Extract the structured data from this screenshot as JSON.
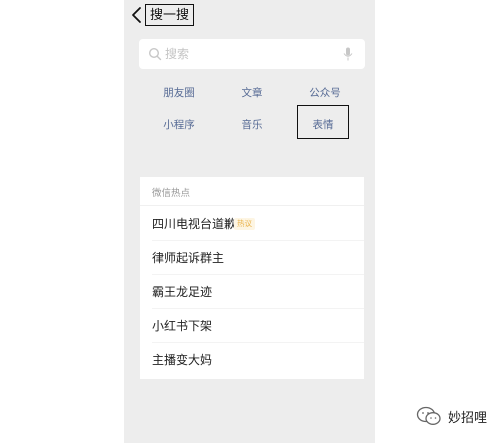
{
  "header": {
    "title": "搜一搜"
  },
  "search": {
    "placeholder": "搜索"
  },
  "categories": [
    {
      "label": "朋友圈"
    },
    {
      "label": "文章"
    },
    {
      "label": "公众号"
    },
    {
      "label": "小程序"
    },
    {
      "label": "音乐"
    },
    {
      "label": "表情"
    }
  ],
  "hot": {
    "header": "微信热点",
    "items": [
      {
        "text": "四川电视台道歉",
        "badge": "热议"
      },
      {
        "text": "律师起诉群主"
      },
      {
        "text": "霸王龙足迹"
      },
      {
        "text": "小红书下架"
      },
      {
        "text": "主播变大妈"
      }
    ]
  },
  "watermark": {
    "text": "妙招哩"
  },
  "colors": {
    "background": "#ededed",
    "link": "#576b95",
    "badge": "#e9b24a"
  }
}
